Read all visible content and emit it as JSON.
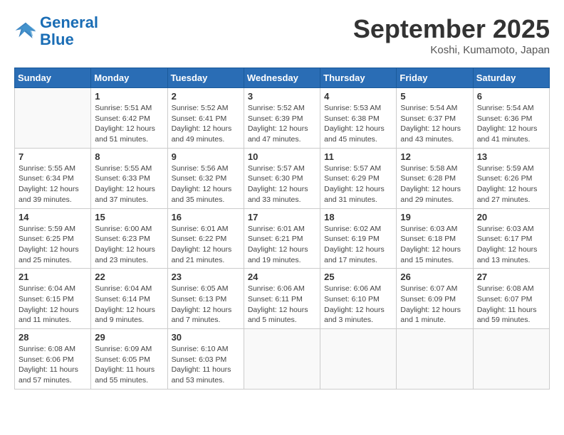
{
  "logo": {
    "text_general": "General",
    "text_blue": "Blue"
  },
  "header": {
    "month": "September 2025",
    "location": "Koshi, Kumamoto, Japan"
  },
  "weekdays": [
    "Sunday",
    "Monday",
    "Tuesday",
    "Wednesday",
    "Thursday",
    "Friday",
    "Saturday"
  ],
  "weeks": [
    [
      {
        "day": "",
        "info": ""
      },
      {
        "day": "1",
        "info": "Sunrise: 5:51 AM\nSunset: 6:42 PM\nDaylight: 12 hours\nand 51 minutes."
      },
      {
        "day": "2",
        "info": "Sunrise: 5:52 AM\nSunset: 6:41 PM\nDaylight: 12 hours\nand 49 minutes."
      },
      {
        "day": "3",
        "info": "Sunrise: 5:52 AM\nSunset: 6:39 PM\nDaylight: 12 hours\nand 47 minutes."
      },
      {
        "day": "4",
        "info": "Sunrise: 5:53 AM\nSunset: 6:38 PM\nDaylight: 12 hours\nand 45 minutes."
      },
      {
        "day": "5",
        "info": "Sunrise: 5:54 AM\nSunset: 6:37 PM\nDaylight: 12 hours\nand 43 minutes."
      },
      {
        "day": "6",
        "info": "Sunrise: 5:54 AM\nSunset: 6:36 PM\nDaylight: 12 hours\nand 41 minutes."
      }
    ],
    [
      {
        "day": "7",
        "info": "Sunrise: 5:55 AM\nSunset: 6:34 PM\nDaylight: 12 hours\nand 39 minutes."
      },
      {
        "day": "8",
        "info": "Sunrise: 5:55 AM\nSunset: 6:33 PM\nDaylight: 12 hours\nand 37 minutes."
      },
      {
        "day": "9",
        "info": "Sunrise: 5:56 AM\nSunset: 6:32 PM\nDaylight: 12 hours\nand 35 minutes."
      },
      {
        "day": "10",
        "info": "Sunrise: 5:57 AM\nSunset: 6:30 PM\nDaylight: 12 hours\nand 33 minutes."
      },
      {
        "day": "11",
        "info": "Sunrise: 5:57 AM\nSunset: 6:29 PM\nDaylight: 12 hours\nand 31 minutes."
      },
      {
        "day": "12",
        "info": "Sunrise: 5:58 AM\nSunset: 6:28 PM\nDaylight: 12 hours\nand 29 minutes."
      },
      {
        "day": "13",
        "info": "Sunrise: 5:59 AM\nSunset: 6:26 PM\nDaylight: 12 hours\nand 27 minutes."
      }
    ],
    [
      {
        "day": "14",
        "info": "Sunrise: 5:59 AM\nSunset: 6:25 PM\nDaylight: 12 hours\nand 25 minutes."
      },
      {
        "day": "15",
        "info": "Sunrise: 6:00 AM\nSunset: 6:23 PM\nDaylight: 12 hours\nand 23 minutes."
      },
      {
        "day": "16",
        "info": "Sunrise: 6:01 AM\nSunset: 6:22 PM\nDaylight: 12 hours\nand 21 minutes."
      },
      {
        "day": "17",
        "info": "Sunrise: 6:01 AM\nSunset: 6:21 PM\nDaylight: 12 hours\nand 19 minutes."
      },
      {
        "day": "18",
        "info": "Sunrise: 6:02 AM\nSunset: 6:19 PM\nDaylight: 12 hours\nand 17 minutes."
      },
      {
        "day": "19",
        "info": "Sunrise: 6:03 AM\nSunset: 6:18 PM\nDaylight: 12 hours\nand 15 minutes."
      },
      {
        "day": "20",
        "info": "Sunrise: 6:03 AM\nSunset: 6:17 PM\nDaylight: 12 hours\nand 13 minutes."
      }
    ],
    [
      {
        "day": "21",
        "info": "Sunrise: 6:04 AM\nSunset: 6:15 PM\nDaylight: 12 hours\nand 11 minutes."
      },
      {
        "day": "22",
        "info": "Sunrise: 6:04 AM\nSunset: 6:14 PM\nDaylight: 12 hours\nand 9 minutes."
      },
      {
        "day": "23",
        "info": "Sunrise: 6:05 AM\nSunset: 6:13 PM\nDaylight: 12 hours\nand 7 minutes."
      },
      {
        "day": "24",
        "info": "Sunrise: 6:06 AM\nSunset: 6:11 PM\nDaylight: 12 hours\nand 5 minutes."
      },
      {
        "day": "25",
        "info": "Sunrise: 6:06 AM\nSunset: 6:10 PM\nDaylight: 12 hours\nand 3 minutes."
      },
      {
        "day": "26",
        "info": "Sunrise: 6:07 AM\nSunset: 6:09 PM\nDaylight: 12 hours\nand 1 minute."
      },
      {
        "day": "27",
        "info": "Sunrise: 6:08 AM\nSunset: 6:07 PM\nDaylight: 11 hours\nand 59 minutes."
      }
    ],
    [
      {
        "day": "28",
        "info": "Sunrise: 6:08 AM\nSunset: 6:06 PM\nDaylight: 11 hours\nand 57 minutes."
      },
      {
        "day": "29",
        "info": "Sunrise: 6:09 AM\nSunset: 6:05 PM\nDaylight: 11 hours\nand 55 minutes."
      },
      {
        "day": "30",
        "info": "Sunrise: 6:10 AM\nSunset: 6:03 PM\nDaylight: 11 hours\nand 53 minutes."
      },
      {
        "day": "",
        "info": ""
      },
      {
        "day": "",
        "info": ""
      },
      {
        "day": "",
        "info": ""
      },
      {
        "day": "",
        "info": ""
      }
    ]
  ]
}
